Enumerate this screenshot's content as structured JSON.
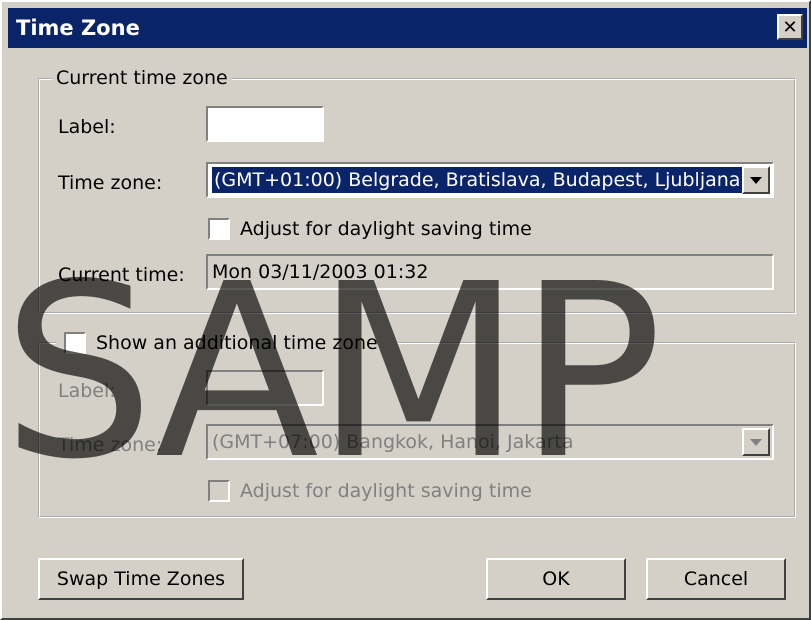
{
  "window": {
    "title": "Time Zone",
    "close_icon": "close-icon"
  },
  "current": {
    "group_title": "Current time zone",
    "label_caption": "Label:",
    "label_value": "",
    "tz_caption": "Time zone:",
    "tz_value": "(GMT+01:00) Belgrade, Bratislava, Budapest, Ljubljana",
    "dst_label": "Adjust for daylight saving time",
    "dst_checked": false,
    "time_caption": "Current time:",
    "time_value": "Mon 03/11/2003 01:32"
  },
  "additional": {
    "checkbox_label": "Show an additional time zone",
    "checked": false,
    "label_caption": "Label:",
    "label_value": "",
    "tz_caption": "Time zone:",
    "tz_value": "(GMT+07:00) Bangkok, Hanoi, Jakarta",
    "dst_label": "Adjust for daylight saving time",
    "dst_checked": false
  },
  "buttons": {
    "swap": "Swap Time Zones",
    "ok": "OK",
    "cancel": "Cancel"
  },
  "watermark": "SAMP"
}
